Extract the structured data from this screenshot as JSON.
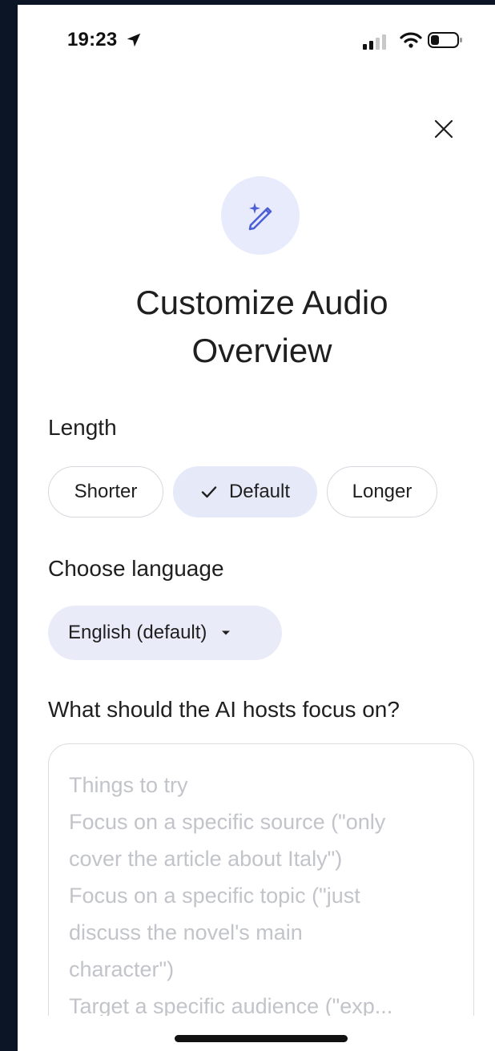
{
  "status_bar": {
    "time": "19:23",
    "icons": [
      "location-arrow-icon",
      "cellular-signal-icon",
      "wifi-icon",
      "battery-icon"
    ]
  },
  "dialog": {
    "close_icon": "close-icon",
    "hero_icon": "magic-pen-icon",
    "title_line1": "Customize Audio",
    "title_line2": "Overview"
  },
  "length": {
    "label": "Length",
    "options": [
      "Shorter",
      "Default",
      "Longer"
    ],
    "selected": "Default"
  },
  "language": {
    "label": "Choose language",
    "selected": "English (default)"
  },
  "focus": {
    "label": "What should the AI hosts focus on?",
    "placeholder_lines": [
      "Things to try",
      "Focus on a specific source (\"only",
      "cover the article about Italy\")",
      "Focus on a specific topic (\"just",
      "discuss the novel's main",
      "character\")",
      "Target a specific audience (\"exp..."
    ]
  },
  "colors": {
    "accent": "#4c5fd5",
    "chip_selected_bg": "#e6e9f8",
    "hero_bg": "#e8ebfb",
    "placeholder_text": "#c2c4c9"
  }
}
